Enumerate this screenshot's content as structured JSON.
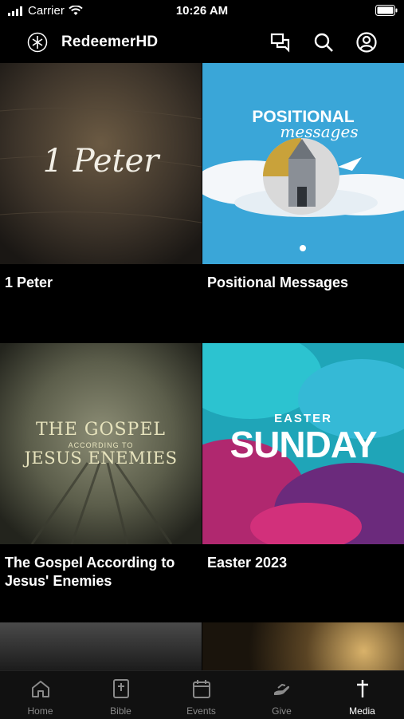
{
  "status": {
    "carrier": "Carrier",
    "time": "10:26 AM"
  },
  "header": {
    "title": "RedeemerHD"
  },
  "series": [
    {
      "title": "1 Peter",
      "art_text": "1 Peter"
    },
    {
      "title": "Positional Messages",
      "art_text_top": "POSITIONAL",
      "art_text_script": "messages"
    },
    {
      "title": "The Gospel According to Jesus' Enemies",
      "art_line1": "THE GOSPEL",
      "art_line2": "ACCORDING TO",
      "art_line3": "JESUS ENEMIES"
    },
    {
      "title": "Easter 2023",
      "art_line1": "EASTER",
      "art_line2": "SUNDAY"
    }
  ],
  "tabs": [
    {
      "label": "Home",
      "icon": "home-icon"
    },
    {
      "label": "Bible",
      "icon": "bible-icon"
    },
    {
      "label": "Events",
      "icon": "calendar-icon"
    },
    {
      "label": "Give",
      "icon": "give-icon"
    },
    {
      "label": "Media",
      "icon": "cross-icon",
      "active": true
    }
  ],
  "colors": {
    "background": "#000000",
    "tabbar": "#111111",
    "inactive_tab": "#8a8a8a"
  }
}
